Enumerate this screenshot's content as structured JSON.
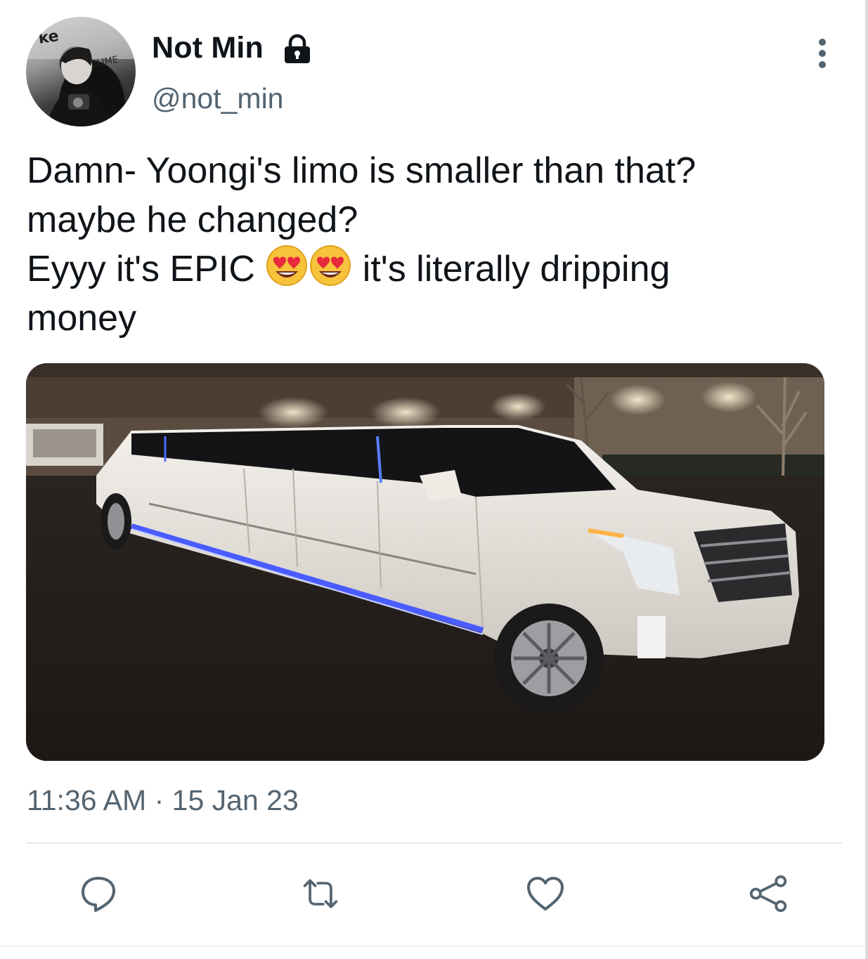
{
  "user": {
    "display_name": "Not Min",
    "handle": "@not_min",
    "avatar_icon": "profile-photo",
    "protected_icon": "lock-icon"
  },
  "tweet": {
    "lines": [
      "Damn- Yoongi's limo is smaller than that?",
      "maybe he changed?",
      "Eyyy it's EPIC",
      "it's literally dripping",
      "money"
    ],
    "emoji": [
      "heart-eyes-emoji",
      "heart-eyes-emoji"
    ],
    "media_alt_icon": "limousine-photo"
  },
  "meta": {
    "time": "11:36 AM",
    "separator": "·",
    "date": "15 Jan 23"
  },
  "actions": [
    "reply-icon",
    "retweet-icon",
    "like-icon",
    "share-icon"
  ],
  "colors": {
    "text": "#0f1419",
    "secondary": "#536471",
    "divider": "#e6e9eb"
  }
}
